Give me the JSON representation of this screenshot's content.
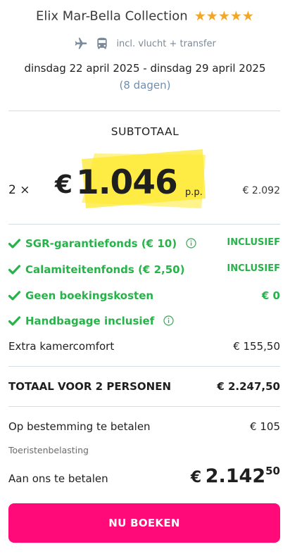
{
  "header": {
    "hotel_name": "Elix Mar-Bella Collection",
    "star_count": 5,
    "star_color": "#f5a623",
    "icons": [
      "plane-icon",
      "bus-icon"
    ],
    "includes_text": "incl. vlucht + transfer",
    "dates": "dinsdag 22 april 2025 - dinsdag 29 april 2025",
    "duration": "(8 dagen)"
  },
  "subtotal": {
    "label": "SUBTOTAAL",
    "quantity": "2 ×",
    "currency": "€",
    "price_per_person": "1.046",
    "per_person_label": "p.p.",
    "total": "€ 2.092",
    "highlight_color": "#fde92e"
  },
  "inclusions": [
    {
      "label": "SGR-garantiefonds  (€ 10)",
      "value": "INCLUSIEF",
      "has_info": true
    },
    {
      "label": "Calamiteitenfonds  (€ 2,50)",
      "value": "INCLUSIEF",
      "has_info": false
    },
    {
      "label": "Geen boekingskosten",
      "value": "€ 0",
      "has_info": false
    },
    {
      "label": "Handbagage inclusief",
      "value": "",
      "has_info": true
    }
  ],
  "extra": {
    "label": "Extra kamercomfort",
    "value": "€ 155,50"
  },
  "total": {
    "label": "TOTAAL VOOR 2 PERSONEN",
    "value": "€ 2.247,50"
  },
  "destination": {
    "label": "Op bestemming te betalen",
    "value": "€ 105",
    "note": "Toeristenbelasting"
  },
  "pay_now": {
    "label": "Aan ons te betalen",
    "currency": "€",
    "integer": "2.142",
    "cents": "50"
  },
  "cta": {
    "label": "NU BOEKEN",
    "color": "#ff0a78"
  },
  "colors": {
    "accent_green": "#27b24a",
    "muted_blue": "#6d8fb0",
    "divider": "#d6dde2"
  }
}
